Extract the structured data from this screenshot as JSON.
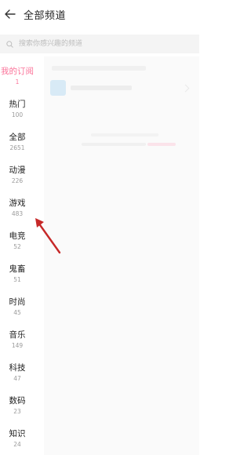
{
  "header": {
    "title": "全部频道"
  },
  "search": {
    "placeholder": "搜索你感兴趣的频道"
  },
  "sidebar": {
    "items": [
      {
        "label": "我的订阅",
        "count": "1",
        "active": true
      },
      {
        "label": "热门",
        "count": "100"
      },
      {
        "label": "全部",
        "count": "2651"
      },
      {
        "label": "动漫",
        "count": "226"
      },
      {
        "label": "游戏",
        "count": "483"
      },
      {
        "label": "电竞",
        "count": "52"
      },
      {
        "label": "鬼畜",
        "count": "51"
      },
      {
        "label": "时尚",
        "count": "45"
      },
      {
        "label": "音乐",
        "count": "149"
      },
      {
        "label": "科技",
        "count": "47"
      },
      {
        "label": "数码",
        "count": "23"
      },
      {
        "label": "知识",
        "count": "24"
      }
    ]
  },
  "colors": {
    "accent": "#fb7299",
    "arrow": "#c62828"
  },
  "icons": {
    "back": "back-arrow-icon",
    "search": "search-icon",
    "annotation": "annotation-arrow-icon"
  }
}
